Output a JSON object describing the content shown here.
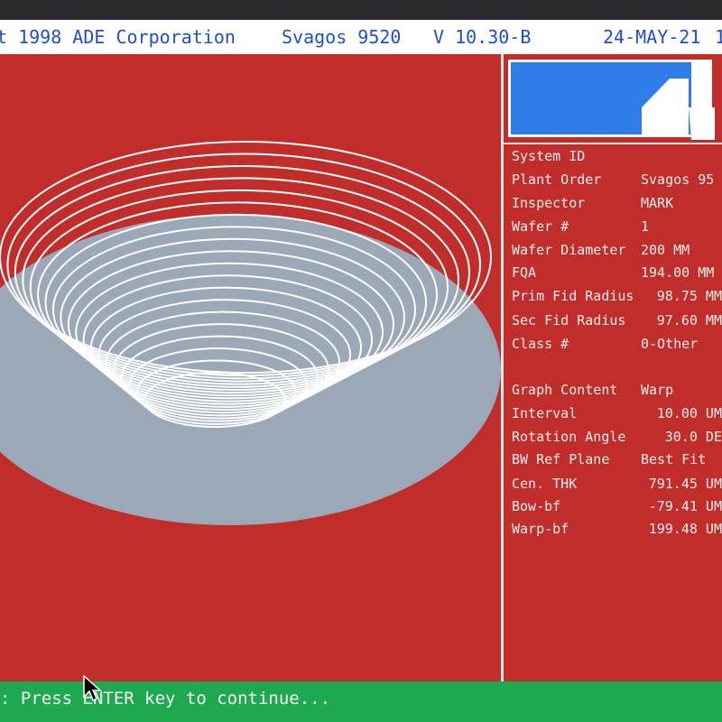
{
  "header": {
    "copyright": "t 1998 ADE Corporation",
    "product": "Svagos 9520",
    "version": "V 10.30-B",
    "date": "24-MAY-21",
    "trailing": "1"
  },
  "colors": {
    "background": "#c12d2a",
    "header_bg": "#ffffff",
    "header_text": "#1d4fd0",
    "logo_blue": "#2e7de8",
    "wafer_fill": "#9ba8b8",
    "contour": "#ffffff",
    "status_bg": "#1ea850"
  },
  "info_panel": {
    "rows": [
      {
        "label": "System ID",
        "value": ""
      },
      {
        "label": "Plant Order",
        "value": "Svagos 95"
      },
      {
        "label": "Inspector",
        "value": "MARK"
      },
      {
        "label": "Wafer #",
        "value": "1"
      },
      {
        "label": "Wafer Diameter",
        "value": "200 MM"
      },
      {
        "label": "FQA",
        "value": "194.00 MM"
      },
      {
        "label": "Prim Fid Radius",
        "value": "98.75 MM"
      },
      {
        "label": "Sec Fid Radius",
        "value": "97.60 MM"
      },
      {
        "label": "Class #",
        "value": "0-Other"
      },
      {
        "label": "Graph Content",
        "value": "Warp"
      },
      {
        "label": "Interval",
        "value": "10.00 UM"
      },
      {
        "label": "Rotation Angle",
        "value": "30.0 DE"
      },
      {
        "label": "BW Ref Plane",
        "value": "Best Fit"
      },
      {
        "label": "Cen. THK",
        "value": "791.45 UM"
      },
      {
        "label": "Bow-bf",
        "value": "-79.41 UM"
      },
      {
        "label": "Warp-bf",
        "value": "199.48 UM"
      }
    ]
  },
  "status_bar": {
    "prompt": ": Press ENTER key to continue..."
  },
  "icons": {
    "logo": "ade-logo-icon",
    "cursor": "mouse-cursor-icon"
  }
}
